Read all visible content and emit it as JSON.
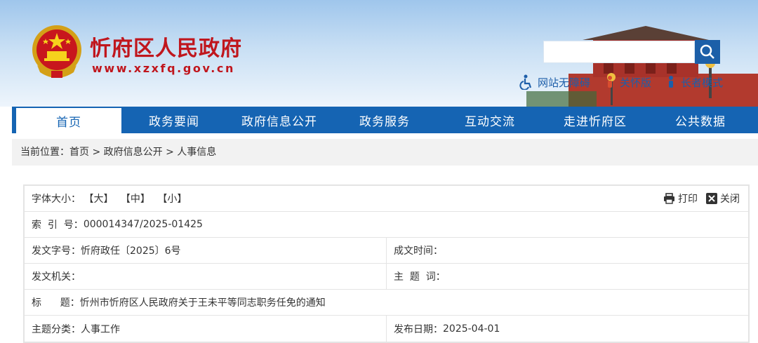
{
  "header": {
    "site_title": "忻府区人民政府",
    "site_url": "www.xzxfq.gov.cn",
    "search_placeholder": "",
    "access_links": [
      {
        "label": "网站无障碍",
        "icon": "accessibility-icon"
      },
      {
        "label": "关怀版",
        "icon": "care-icon"
      },
      {
        "label": "长者模式",
        "icon": "elder-icon"
      }
    ]
  },
  "nav": {
    "items": [
      "首页",
      "政务要闻",
      "政府信息公开",
      "政务服务",
      "互动交流",
      "走进忻府区",
      "公共数据"
    ],
    "active_index": 0
  },
  "breadcrumb": {
    "prefix": "当前位置：",
    "items": [
      "首页",
      "政府信息公开",
      "人事信息"
    ],
    "separator": " > "
  },
  "doc_info": {
    "font_size_label": "字体大小：",
    "font_sizes": [
      "【大】",
      "【中】",
      "【小】"
    ],
    "print_label": "打印",
    "close_label": "关闭",
    "index_label": "索  引  号：",
    "index_value": "000014347/2025-01425",
    "doc_number_label": "发文字号：",
    "doc_number_value": "忻府政任〔2025〕6号",
    "created_label": "成文时间：",
    "created_value": "",
    "issuer_label": "发文机关：",
    "issuer_value": "",
    "subject_words_label": "主  题  词：",
    "subject_words_value": "",
    "title_label": "标      题：",
    "title_value": "忻州市忻府区人民政府关于王未平等同志职务任免的通知",
    "category_label": "主题分类：",
    "category_value": "人事工作",
    "publish_date_label": "发布日期：",
    "publish_date_value": "2025-04-01"
  },
  "colors": {
    "brand_red": "#c0161d",
    "nav_blue": "#1564b3",
    "link_blue": "#1d5ea9"
  }
}
